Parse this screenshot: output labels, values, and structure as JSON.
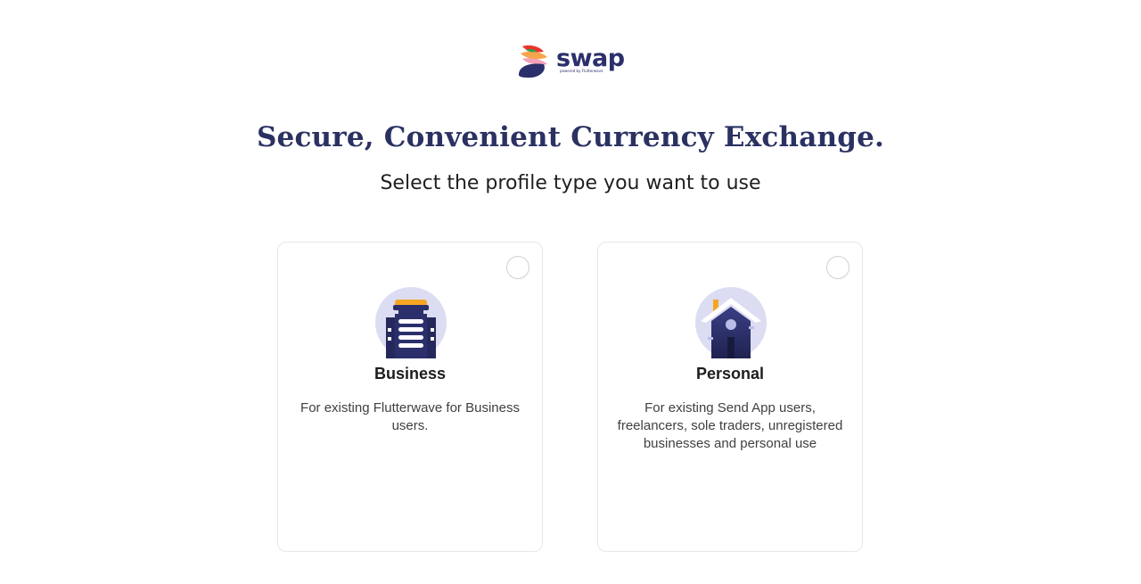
{
  "brand": {
    "name": "swap",
    "tagline": "powered by Flutterwave"
  },
  "headline": "Secure, Convenient Currency Exchange.",
  "subheadline": "Select the profile type you want to use",
  "profiles": [
    {
      "title": "Business",
      "description": "For existing Flutterwave for Business users.",
      "icon": "building-icon",
      "selected": false
    },
    {
      "title": "Personal",
      "description": "For existing Send App users, freelancers, sole traders, unregistered businesses and personal use",
      "icon": "house-icon",
      "selected": false
    }
  ],
  "colors": {
    "headline": "#2b3262",
    "brand_navy": "#2b2f6b",
    "icon_bg": "#dcdcf2",
    "accent_orange": "#f5a623",
    "card_border": "#e7e7e9"
  }
}
